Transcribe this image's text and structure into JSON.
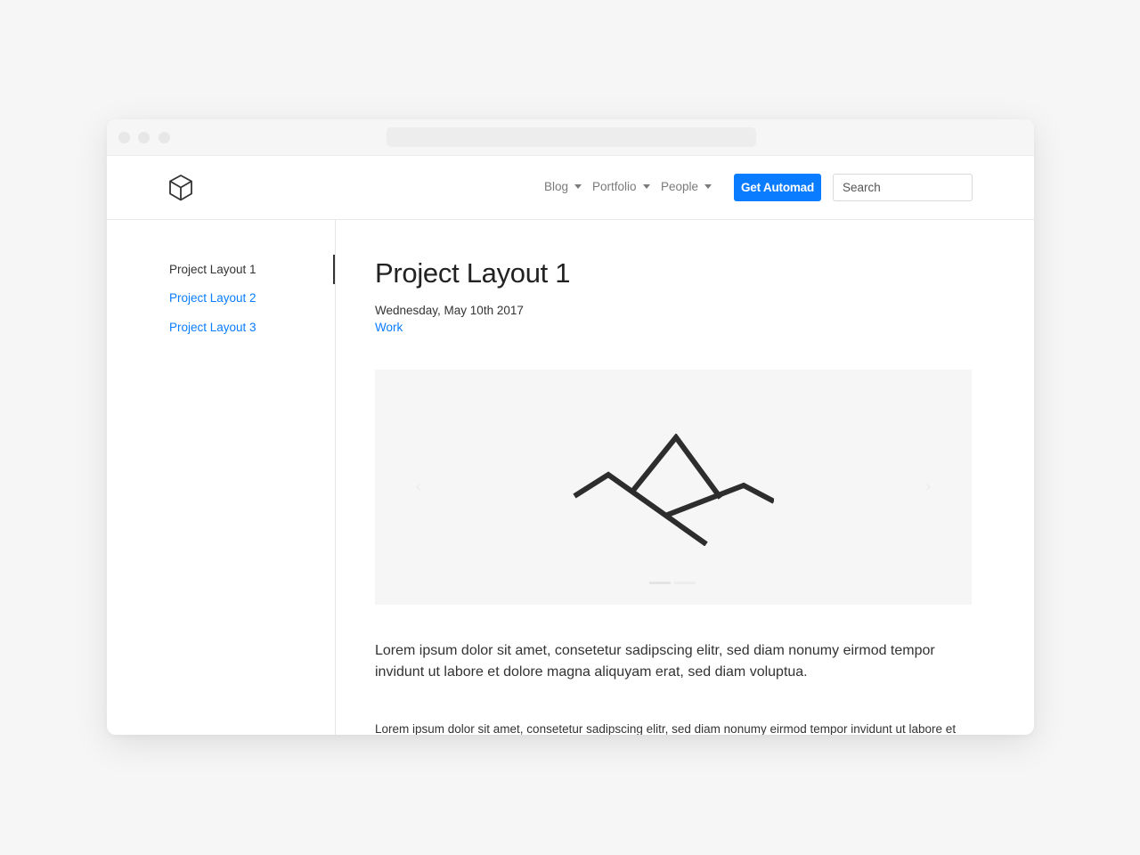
{
  "navbar": {
    "logo_icon": "cube-icon",
    "menu": [
      {
        "label": "Blog"
      },
      {
        "label": "Portfolio"
      },
      {
        "label": "People"
      }
    ],
    "cta_label": "Get Automad",
    "search_placeholder": "Search"
  },
  "sidebar": {
    "items": [
      {
        "label": "Project Layout 1",
        "active": true
      },
      {
        "label": "Project Layout 2",
        "active": false
      },
      {
        "label": "Project Layout 3",
        "active": false
      }
    ]
  },
  "main": {
    "title": "Project Layout 1",
    "date": "Wednesday, May 10th 2017",
    "tag": "Work",
    "carousel": {
      "image_icon": "mountain-icon",
      "prev_glyph": "‹",
      "next_glyph": "›",
      "slide_count": 2,
      "active_slide": 1
    },
    "lead": "Lorem ipsum dolor sit amet, consetetur sadipscing elitr, sed diam nonumy eirmod tempor invidunt ut labore et dolore magna aliquyam erat, sed diam voluptua.",
    "paragraph": "Lorem ipsum dolor sit amet, consetetur sadipscing elitr, sed diam nonumy eirmod tempor invidunt ut labore et"
  },
  "colors": {
    "accent": "#0a7cff",
    "text": "#333333",
    "muted": "#7a7a7a",
    "background": "#f6f6f6"
  }
}
